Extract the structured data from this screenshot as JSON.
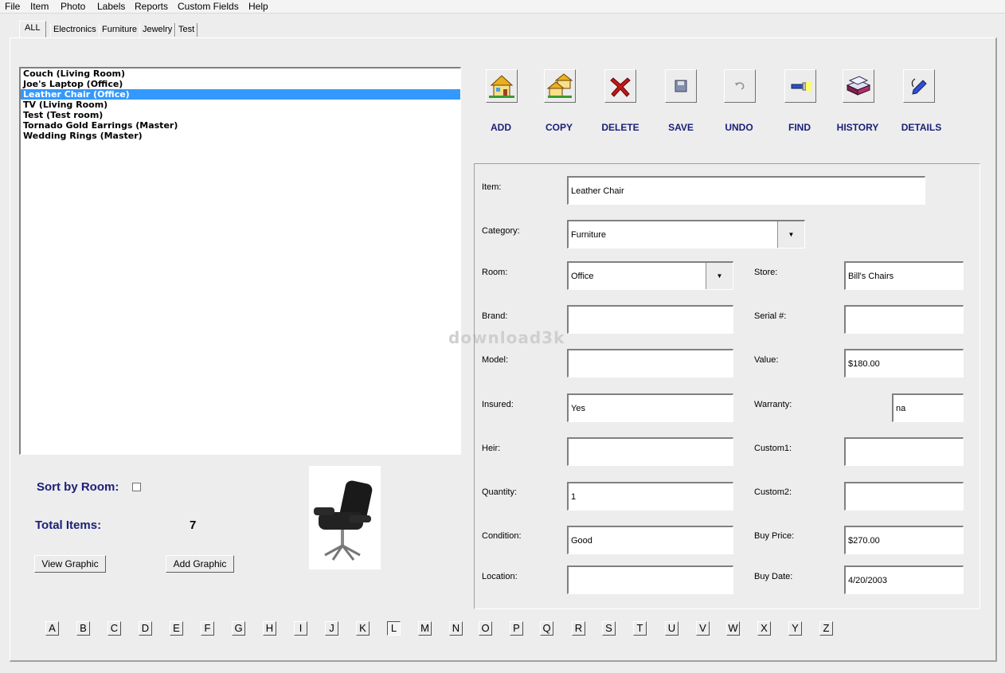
{
  "menu": [
    "File",
    "Item",
    "Photo",
    "Labels",
    "Reports",
    "Custom Fields",
    "Help"
  ],
  "tabs": [
    "ALL",
    "Electronics",
    "Furniture",
    "Jewelry",
    "Test"
  ],
  "items": [
    "Couch (Living Room)",
    "Joe's Laptop (Office)",
    "Leather Chair (Office)",
    "TV (Living Room)",
    "Test (Test room)",
    "Tornado Gold Earrings (Master)",
    "Wedding Rings (Master)"
  ],
  "selected_index": 2,
  "toolbar": {
    "add": "ADD",
    "copy": "COPY",
    "delete": "DELETE",
    "save": "SAVE",
    "undo": "UNDO",
    "find": "FIND",
    "history": "HISTORY",
    "details": "DETAILS"
  },
  "labels": {
    "item": "Item:",
    "category": "Category:",
    "room": "Room:",
    "store": "Store:",
    "brand": "Brand:",
    "serial": "Serial #:",
    "model": "Model:",
    "value": "Value:",
    "insured": "Insured:",
    "warranty": "Warranty:",
    "heir": "Heir:",
    "custom1": "Custom1:",
    "quantity": "Quantity:",
    "custom2": "Custom2:",
    "condition": "Condition:",
    "buy_price": "Buy Price:",
    "location": "Location:",
    "buy_date": "Buy Date:"
  },
  "values": {
    "item": "Leather Chair",
    "category": "Furniture",
    "room": "Office",
    "store": "Bill's Chairs",
    "brand": "",
    "serial": "",
    "model": "",
    "value": "$180.00",
    "insured": "Yes",
    "warranty": "na",
    "heir": "",
    "custom1": "",
    "quantity": "1",
    "custom2": "",
    "condition": "Good",
    "buy_price": "$270.00",
    "location": "",
    "buy_date": "4/20/2003"
  },
  "sort_by_room_label": "Sort by Room:",
  "total_items_label": "Total Items:",
  "total_items": "7",
  "view_graphic": "View Graphic",
  "add_graphic": "Add Graphic",
  "alphabet": [
    "A",
    "B",
    "C",
    "D",
    "E",
    "F",
    "G",
    "H",
    "I",
    "J",
    "K",
    "L",
    "M",
    "N",
    "O",
    "P",
    "Q",
    "R",
    "S",
    "T",
    "U",
    "V",
    "W",
    "X",
    "Y",
    "Z"
  ],
  "alphabet_pressed": "L",
  "watermark": "download3k"
}
